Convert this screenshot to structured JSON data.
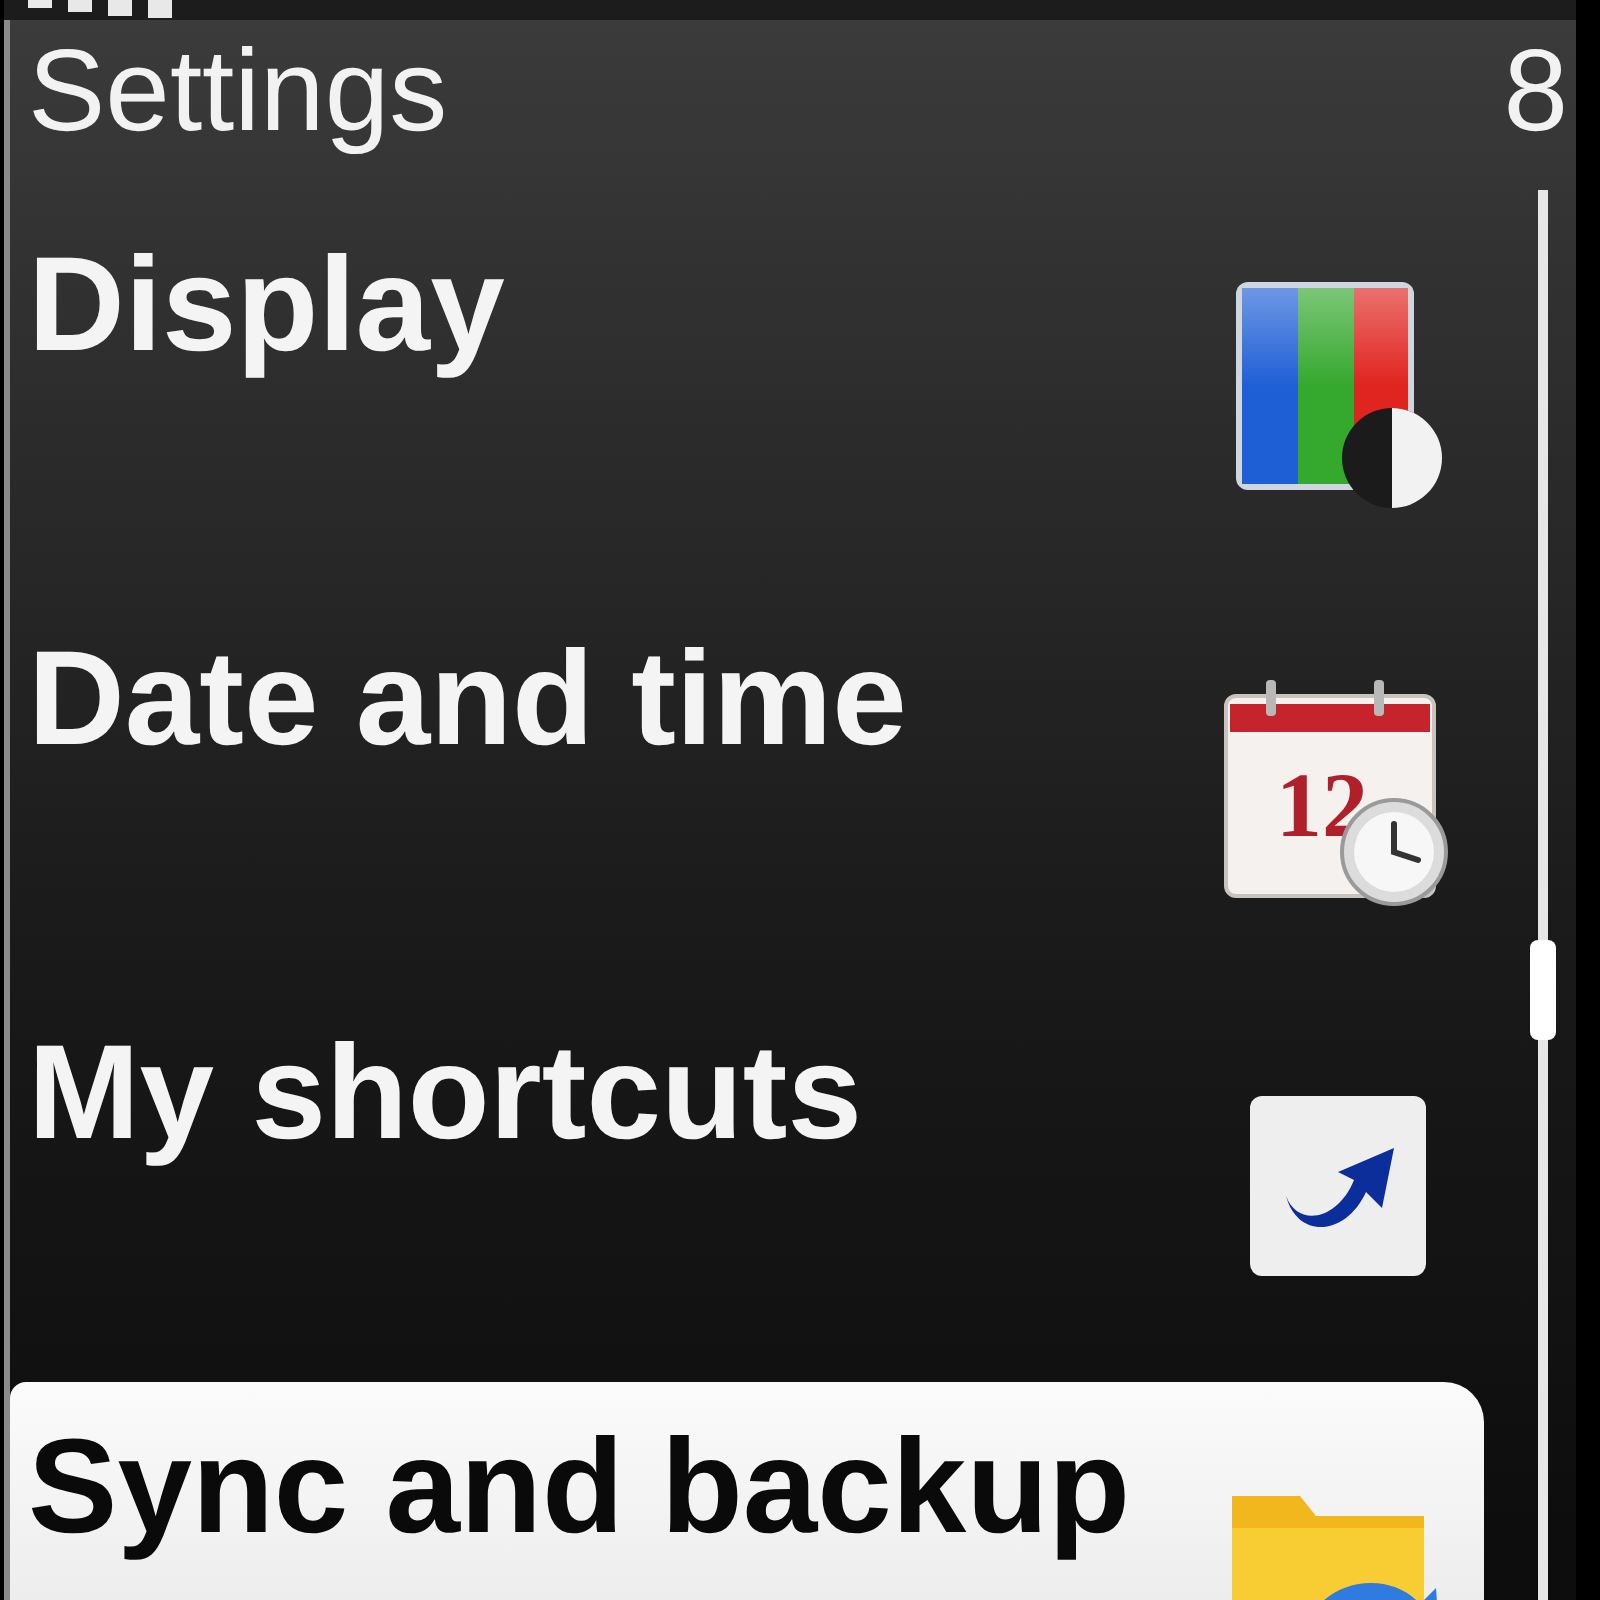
{
  "header": {
    "title": "Settings",
    "count": "8"
  },
  "items": [
    {
      "label": "Display",
      "kind": "display",
      "selected": false
    },
    {
      "label": "Date and time",
      "kind": "calendar",
      "icon_text": "12",
      "selected": false
    },
    {
      "label": "My shortcuts",
      "kind": "shortcut",
      "selected": false
    },
    {
      "label": "Sync and backup",
      "kind": "folder",
      "selected": true
    }
  ]
}
